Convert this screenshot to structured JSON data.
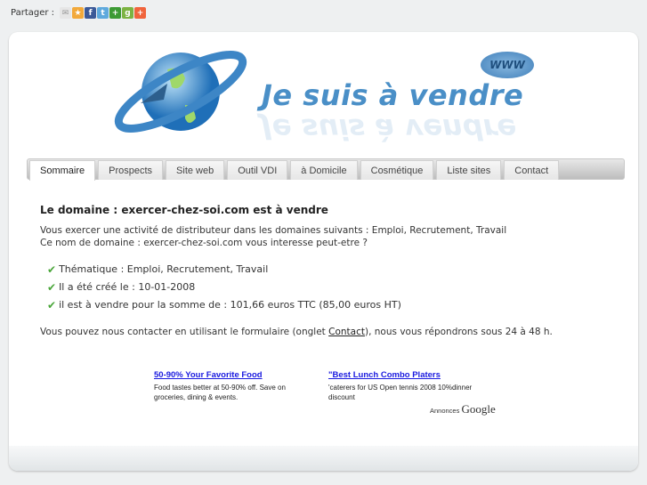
{
  "share": {
    "label": "Partager :",
    "icons": [
      {
        "name": "email-icon",
        "color": "#e6e6e6",
        "glyph": "✉"
      },
      {
        "name": "favorite-star-icon",
        "color": "#f2a93b",
        "glyph": "★"
      },
      {
        "name": "facebook-icon",
        "color": "#3b5998",
        "glyph": "f"
      },
      {
        "name": "twitter-icon",
        "color": "#5ea9dd",
        "glyph": "t"
      },
      {
        "name": "add-green-icon",
        "color": "#3c9a34",
        "glyph": "+"
      },
      {
        "name": "google-icon",
        "color": "#7cb342",
        "glyph": "g"
      },
      {
        "name": "addthis-icon",
        "color": "#f0643c",
        "glyph": "+"
      }
    ]
  },
  "logo": {
    "text": "Je suis à vendre",
    "bubble": "WWW"
  },
  "tabs": [
    "Sommaire",
    "Prospects",
    "Site web",
    "Outil VDI",
    "à Domicile",
    "Cosmétique",
    "Liste sites",
    "Contact"
  ],
  "content": {
    "title": "Le domaine : exercer-chez-soi.com est à vendre",
    "intro1": "Vous exercer une activité de distributeur dans les domaines suivants : Emploi, Recrutement, Travail",
    "intro2": "Ce nom de domaine : exercer-chez-soi.com vous interesse peut-etre ?",
    "bullets": [
      "Thématique : Emploi, Recrutement, Travail",
      "Il a été créé le : 10-01-2008",
      "il est à vendre pour la somme de : 101,66 euros TTC (85,00 euros HT)"
    ],
    "contact_before": "Vous pouvez nous contacter en utilisant le formulaire (onglet ",
    "contact_link": "Contact",
    "contact_after": "), nous vous répondrons sous 24 à 48 h."
  },
  "ads": [
    {
      "title": "50-90% Your Favorite Food",
      "text": "Food tastes better at 50-90% off. Save on groceries, dining & events."
    },
    {
      "title": "\"Best Lunch Combo Platers",
      "text": "'caterers for US Open tennis 2008 10%dinner discount"
    }
  ],
  "annonces": {
    "label": "Annonces",
    "brand": "Google"
  }
}
